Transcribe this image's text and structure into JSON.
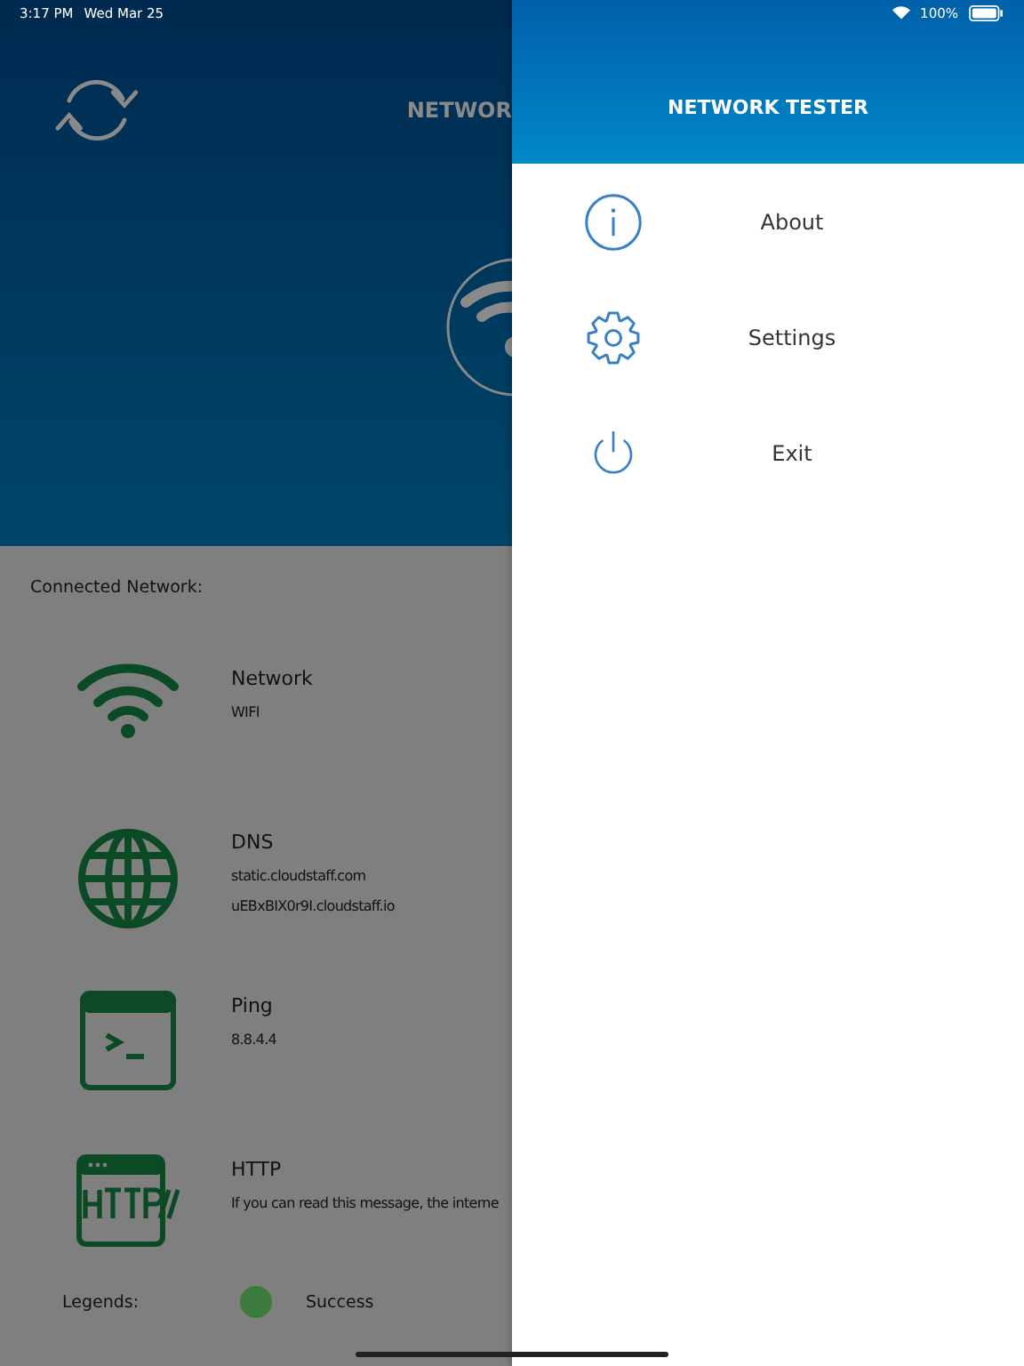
{
  "status_bar": {
    "time": "3:17 PM",
    "date": "Wed Mar 25",
    "battery": "100%"
  },
  "main": {
    "title": "NETWOR",
    "section_label": "Connected Network:",
    "checks": [
      {
        "kind": "network",
        "title": "Network",
        "lines": [
          "WIFI"
        ]
      },
      {
        "kind": "dns",
        "title": "DNS",
        "lines": [
          "static.cloudstaff.com",
          "uEBxBIX0r9I.cloudstaff.io"
        ]
      },
      {
        "kind": "ping",
        "title": "Ping",
        "lines": [
          "8.8.4.4"
        ]
      },
      {
        "kind": "http",
        "title": "HTTP",
        "lines": [
          "If you can read this message, the interne"
        ]
      }
    ],
    "legend": {
      "label": "Legends:",
      "items": [
        {
          "label": "Success",
          "color": "#3d7a3d"
        }
      ]
    }
  },
  "drawer": {
    "title": "NETWORK TESTER",
    "items": [
      {
        "kind": "about",
        "label": "About"
      },
      {
        "kind": "settings",
        "label": "Settings"
      },
      {
        "kind": "exit",
        "label": "Exit"
      }
    ]
  }
}
